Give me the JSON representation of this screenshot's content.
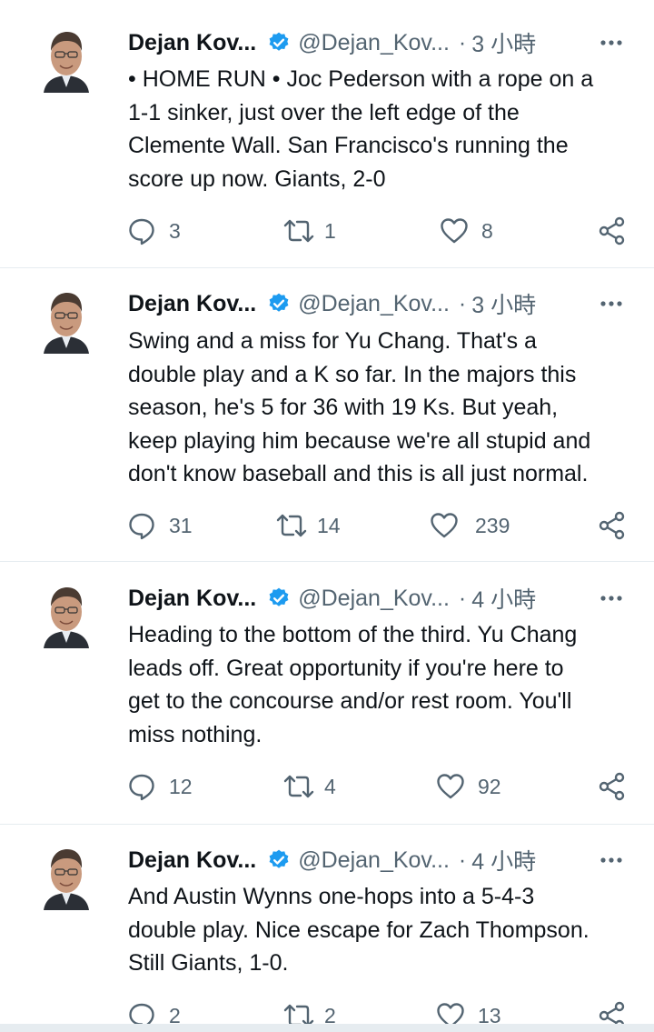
{
  "tweets": [
    {
      "author": "Dejan Kov...",
      "handle": "@Dejan_Kov...",
      "dot": "·",
      "time": "3 小時",
      "text": "• HOME RUN • Joc Pederson with a rope on a\n1-1 sinker, just over the left edge of the\nClemente Wall. San Francisco's running the\nscore up now. Giants, 2-0",
      "replies": "3",
      "retweets": "1",
      "likes": "8"
    },
    {
      "author": "Dejan Kov...",
      "handle": "@Dejan_Kov...",
      "dot": "·",
      "time": "3 小時",
      "text": "Swing and a miss for Yu Chang. That's a\ndouble play and a K so far. In the majors this\nseason, he's 5 for 36 with 19 Ks. But yeah,\nkeep playing him because we're all stupid and\ndon't know baseball and this is all just normal.",
      "replies": "31",
      "retweets": "14",
      "likes": "239"
    },
    {
      "author": "Dejan Kov...",
      "handle": "@Dejan_Kov...",
      "dot": "·",
      "time": "4 小時",
      "text": "Heading to the bottom of the third. Yu Chang\nleads off. Great opportunity if you're here to\nget to the concourse and/or rest room. You'll\nmiss nothing.",
      "replies": "12",
      "retweets": "4",
      "likes": "92"
    },
    {
      "author": "Dejan Kov...",
      "handle": "@Dejan_Kov...",
      "dot": "·",
      "time": "4 小時",
      "text": "And Austin Wynns one-hops into a 5-4-3\ndouble play. Nice escape for Zach Thompson.\nStill Giants, 1-0.",
      "replies": "2",
      "retweets": "2",
      "likes": "13"
    }
  ],
  "icons": {
    "verified": "verified-badge-icon",
    "more": "more-options-icon",
    "reply": "reply-icon",
    "retweet": "retweet-icon",
    "like": "heart-icon",
    "share": "share-icon"
  },
  "colors": {
    "text": "#0f1419",
    "secondary": "#536471",
    "verified": "#1d9bf0",
    "divider": "#e6ecf0"
  }
}
